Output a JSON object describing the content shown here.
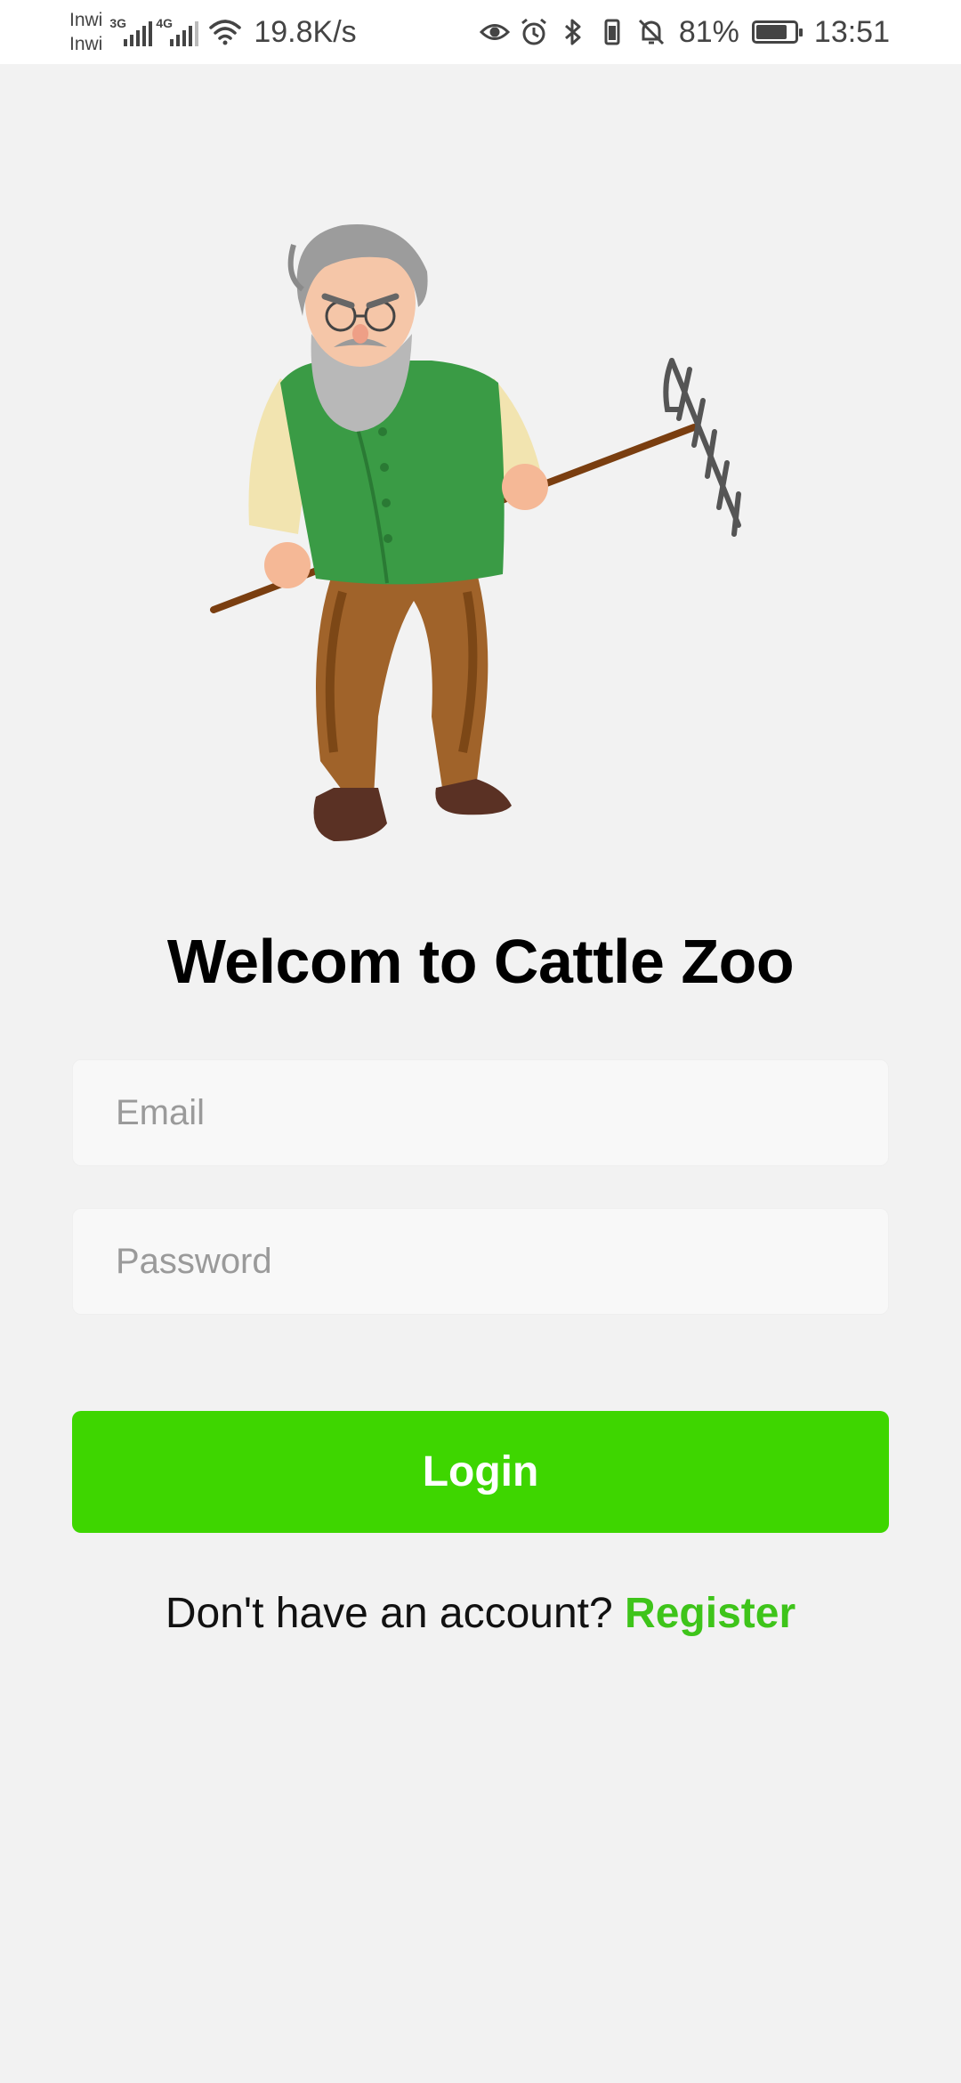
{
  "status_bar": {
    "carrier_1": "Inwi",
    "carrier_2": "Inwi",
    "network_1": "3G",
    "network_2": "4G",
    "net_speed": "19.8K/s",
    "battery_percent": "81%",
    "battery_level": 0.81,
    "time": "13:51",
    "icons": [
      "signal-icon",
      "wifi-icon",
      "eye-icon",
      "alarm-icon",
      "bluetooth-icon",
      "vibrate-icon",
      "bell-off-icon",
      "battery-icon"
    ]
  },
  "hero": {
    "image": "farmer-with-rake-illustration"
  },
  "login": {
    "title": "Welcom to Cattle Zoo",
    "email_placeholder": "Email",
    "email_value": "",
    "password_placeholder": "Password",
    "password_value": "",
    "login_button_label": "Login",
    "register_prompt": "Don't have an account?",
    "register_link_label": "Register"
  },
  "colors": {
    "accent": "#3ed600",
    "link": "#3ec41a",
    "background": "#f2f2f2",
    "field_bg": "#f8f8f8"
  }
}
